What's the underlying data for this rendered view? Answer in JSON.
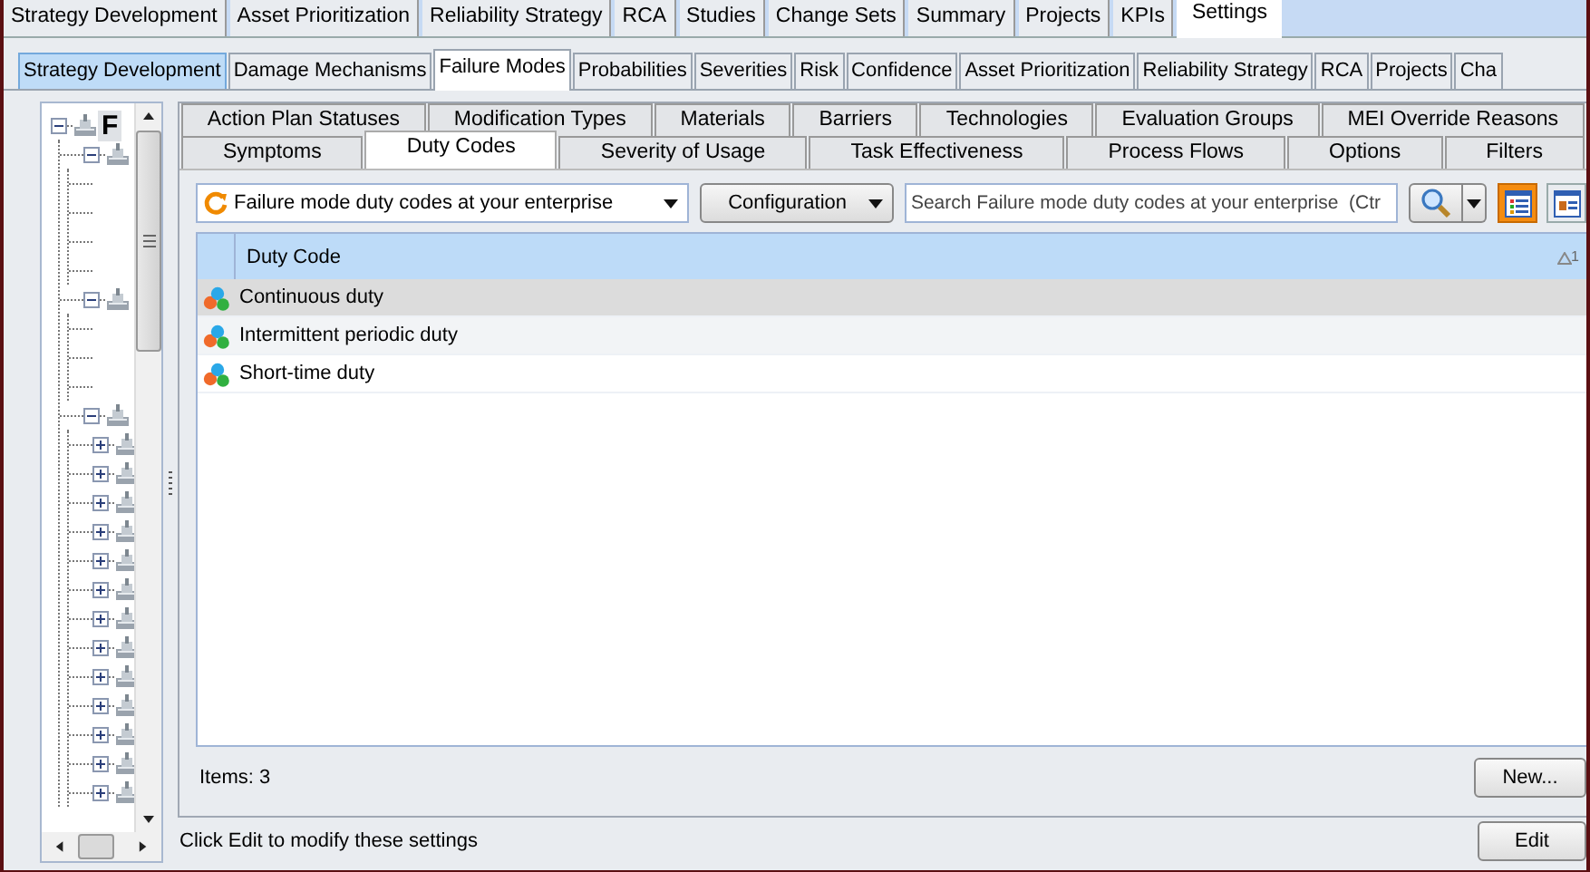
{
  "main_tabs": [
    {
      "label": "Strategy Development",
      "selected": false
    },
    {
      "label": "Asset Prioritization",
      "selected": false
    },
    {
      "label": "Reliability Strategy",
      "selected": false
    },
    {
      "label": "RCA",
      "selected": false
    },
    {
      "label": "Studies",
      "selected": false
    },
    {
      "label": "Change Sets",
      "selected": false
    },
    {
      "label": "Summary",
      "selected": false
    },
    {
      "label": "Projects",
      "selected": false
    },
    {
      "label": "KPIs",
      "selected": false
    },
    {
      "label": "Settings",
      "selected": true
    }
  ],
  "section_tabs": [
    {
      "label": "Strategy Development",
      "selected": false,
      "highlighted": true
    },
    {
      "label": "Damage Mechanisms",
      "selected": false,
      "highlighted": false
    },
    {
      "label": "Failure Modes",
      "selected": true,
      "highlighted": false
    },
    {
      "label": "Probabilities",
      "selected": false,
      "highlighted": false
    },
    {
      "label": "Severities",
      "selected": false,
      "highlighted": false
    },
    {
      "label": "Risk",
      "selected": false,
      "highlighted": false
    },
    {
      "label": "Confidence",
      "selected": false,
      "highlighted": false
    },
    {
      "label": "Asset Prioritization",
      "selected": false,
      "highlighted": false
    },
    {
      "label": "Reliability Strategy",
      "selected": false,
      "highlighted": false
    },
    {
      "label": "RCA",
      "selected": false,
      "highlighted": false
    },
    {
      "label": "Projects",
      "selected": false,
      "highlighted": false
    },
    {
      "label": "Cha",
      "selected": false,
      "highlighted": false
    }
  ],
  "tree": {
    "label": "F",
    "expanded": true,
    "children": [
      {
        "kind": "node",
        "expanded": true,
        "children": [
          {
            "kind": "offscreen"
          },
          {
            "kind": "offscreen"
          },
          {
            "kind": "offscreen"
          },
          {
            "kind": "offscreen"
          }
        ]
      },
      {
        "kind": "node",
        "expanded": true,
        "children": [
          {
            "kind": "offscreen"
          },
          {
            "kind": "offscreen"
          },
          {
            "kind": "offscreen"
          }
        ]
      },
      {
        "kind": "node",
        "expanded": true,
        "children": [
          {
            "kind": "node",
            "expanded": false
          },
          {
            "kind": "node",
            "expanded": false
          },
          {
            "kind": "node",
            "expanded": false
          },
          {
            "kind": "node",
            "expanded": false
          },
          {
            "kind": "node",
            "expanded": false
          },
          {
            "kind": "node",
            "expanded": false
          },
          {
            "kind": "node",
            "expanded": false
          },
          {
            "kind": "node",
            "expanded": false
          },
          {
            "kind": "node",
            "expanded": false
          },
          {
            "kind": "node",
            "expanded": false
          },
          {
            "kind": "node",
            "expanded": false
          },
          {
            "kind": "node",
            "expanded": false
          },
          {
            "kind": "node",
            "expanded": false
          }
        ]
      }
    ]
  },
  "settings_tab_rows": [
    {
      "tabs": [
        {
          "label": "Action Plan Statuses",
          "selected": false
        },
        {
          "label": "Modification Types",
          "selected": false
        },
        {
          "label": "Materials",
          "selected": false
        },
        {
          "label": "Barriers",
          "selected": false
        },
        {
          "label": "Technologies",
          "selected": false
        },
        {
          "label": "Evaluation Groups",
          "selected": false
        },
        {
          "label": "MEI Override Reasons",
          "selected": false
        }
      ]
    },
    {
      "tabs": [
        {
          "label": "Symptoms",
          "selected": false
        },
        {
          "label": "Duty Codes",
          "selected": true
        },
        {
          "label": "Severity of Usage",
          "selected": false
        },
        {
          "label": "Task Effectiveness",
          "selected": false
        },
        {
          "label": "Process Flows",
          "selected": false
        },
        {
          "label": "Options",
          "selected": false
        },
        {
          "label": "Filters",
          "selected": false
        }
      ]
    }
  ],
  "toolbar": {
    "scope": "Failure mode duty codes at your enterprise",
    "configuration": "Configuration",
    "search_placeholder": "Search Failure mode duty codes at your enterprise  (Ctr",
    "views": [
      {
        "kind": "list",
        "selected": true
      },
      {
        "kind": "detail",
        "selected": false
      }
    ]
  },
  "grid": {
    "column": "Duty Code",
    "sort_order": "1",
    "rows": [
      {
        "label": "Continuous duty",
        "selected": true
      },
      {
        "label": "Intermittent periodic duty",
        "selected": false
      },
      {
        "label": "Short-time duty",
        "selected": false
      }
    ]
  },
  "item_count": "Items: 3",
  "new_button": "New...",
  "status_text": "Click Edit to modify these settings",
  "edit_button": "Edit"
}
